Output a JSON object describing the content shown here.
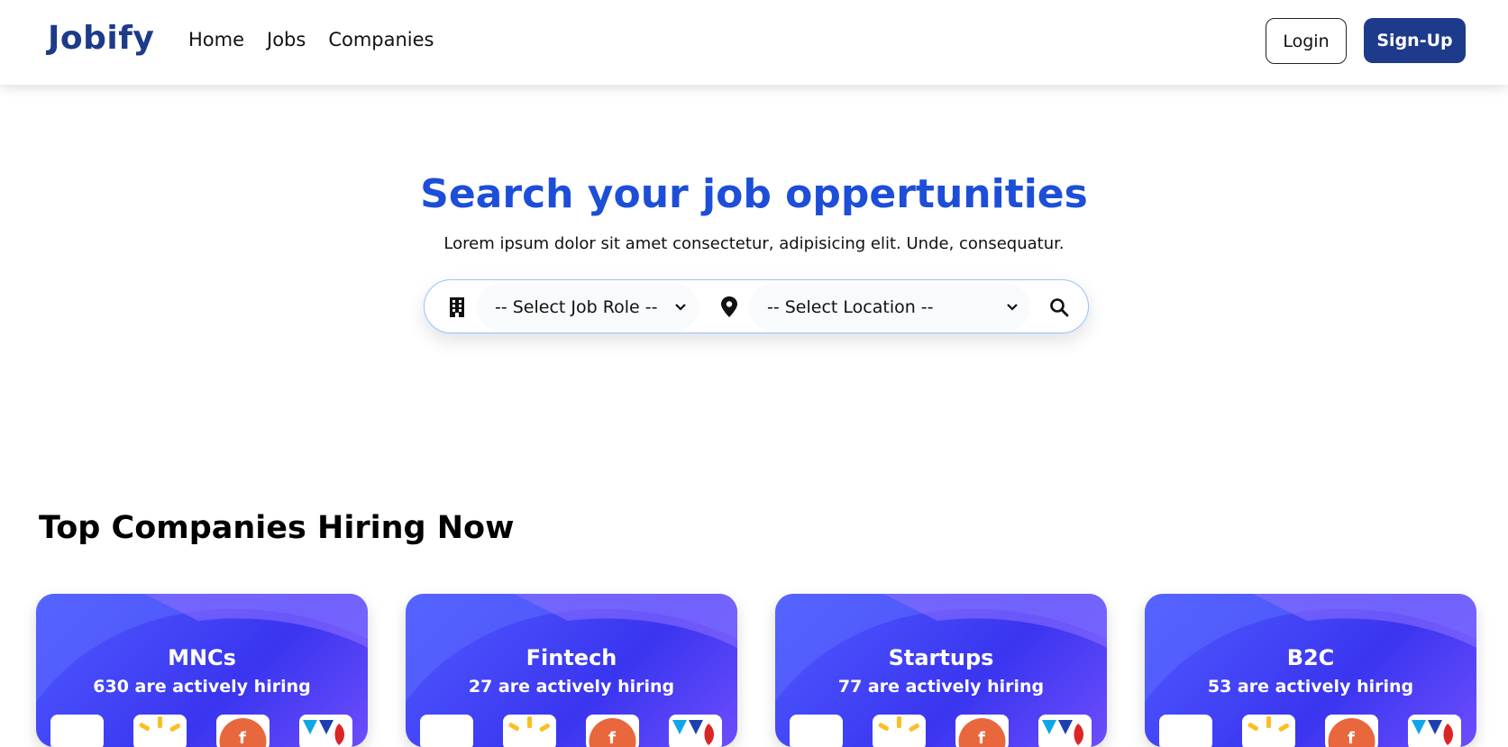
{
  "nav": {
    "logo": "Jobify",
    "links": [
      "Home",
      "Jobs",
      "Companies"
    ],
    "login_label": "Login",
    "signup_label": "Sign-Up"
  },
  "hero": {
    "title": "Search your job oppertunities",
    "subtitle": "Lorem ipsum dolor sit amet consectetur, adipisicing elit. Unde, consequatur."
  },
  "search": {
    "job_role_value": "-- Select Job Role --",
    "location_value": "-- Select Location --",
    "icons": [
      "building-icon",
      "location-pin-icon",
      "search-icon"
    ]
  },
  "section": {
    "title": "Top Companies Hiring Now"
  },
  "cards": [
    {
      "title": "MNCs",
      "subtitle": "630 are actively hiring"
    },
    {
      "title": "Fintech",
      "subtitle": "27 are actively hiring"
    },
    {
      "title": "Startups",
      "subtitle": "77 are actively hiring"
    },
    {
      "title": "B2C",
      "subtitle": "53 are actively hiring"
    }
  ],
  "colors": {
    "brand": "#1e3a8a",
    "hero_title": "#1d4ed8",
    "card_gradient_start": "#4f5bff",
    "card_gradient_end": "#6d4dfc"
  }
}
